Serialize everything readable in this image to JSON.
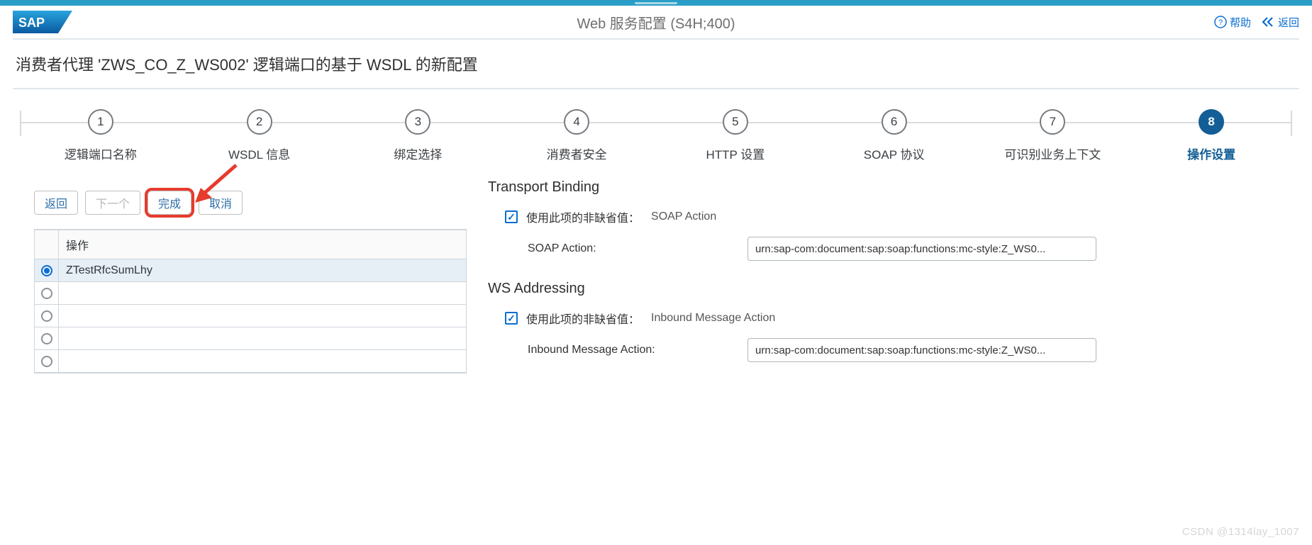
{
  "header": {
    "title": "Web 服务配置 (S4H;400)",
    "help": "帮助",
    "back": "返回"
  },
  "page": {
    "title": "消费者代理 'ZWS_CO_Z_WS002' 逻辑端口的基于 WSDL 的新配置"
  },
  "wizard": {
    "steps": [
      {
        "num": "1",
        "label": "逻辑端口名称"
      },
      {
        "num": "2",
        "label": "WSDL 信息"
      },
      {
        "num": "3",
        "label": "绑定选择"
      },
      {
        "num": "4",
        "label": "消费者安全"
      },
      {
        "num": "5",
        "label": "HTTP 设置"
      },
      {
        "num": "6",
        "label": "SOAP 协议"
      },
      {
        "num": "7",
        "label": "可识别业务上下文"
      },
      {
        "num": "8",
        "label": "操作设置"
      }
    ],
    "active_index": 7
  },
  "buttons": {
    "back": "返回",
    "next": "下一个",
    "finish": "完成",
    "cancel": "取消"
  },
  "table": {
    "header": "操作",
    "rows": [
      {
        "selected": true,
        "text": "ZTestRfcSumLhy"
      },
      {
        "selected": false,
        "text": ""
      },
      {
        "selected": false,
        "text": ""
      },
      {
        "selected": false,
        "text": ""
      },
      {
        "selected": false,
        "text": ""
      }
    ]
  },
  "sections": {
    "transport": {
      "title": "Transport Binding",
      "override_label": "使用此项的非缺省值：",
      "override_sub": "SOAP Action",
      "field_label": "SOAP Action:",
      "field_value": "urn:sap-com:document:sap:soap:functions:mc-style:Z_WS0..."
    },
    "wsa": {
      "title": "WS Addressing",
      "override_label": "使用此项的非缺省值：",
      "override_sub": "Inbound Message Action",
      "field_label": "Inbound Message Action:",
      "field_value": "urn:sap-com:document:sap:soap:functions:mc-style:Z_WS0..."
    }
  },
  "watermark": "CSDN @1314lay_1007"
}
